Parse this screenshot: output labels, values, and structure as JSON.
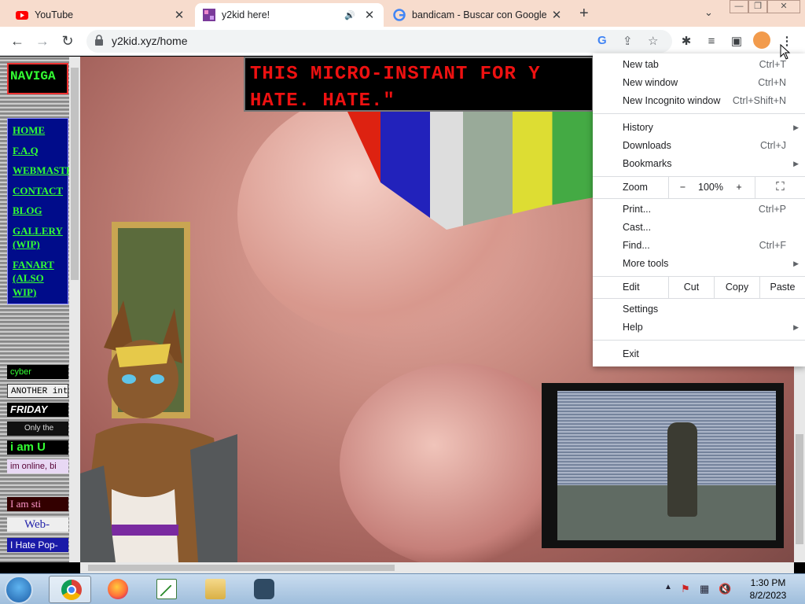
{
  "tabs": [
    {
      "title": "YouTube",
      "favicon": "youtube-icon"
    },
    {
      "title": "y2kid here!",
      "favicon": "site-icon",
      "audio": true
    },
    {
      "title": "bandicam - Buscar con Google",
      "favicon": "google-icon"
    }
  ],
  "address": {
    "url": "y2kid.xyz/home"
  },
  "page": {
    "nav_header": "NAVIGA",
    "nav_links": [
      "HOME",
      "F.A.Q",
      "WEBMASTE",
      "CONTACT",
      "BLOG",
      "GALLERY (WIP)",
      "FANART (ALSO WIP)"
    ],
    "badges": [
      "cyber",
      "ANOTHER inte",
      "FRIDAY",
      "Only the",
      "i am U",
      "im online, bi",
      "I am sti",
      "Web-",
      "I Hate Pop-"
    ],
    "banner_line1": "THIS MICRO-INSTANT FOR Y",
    "banner_line2": "HATE. HATE.\""
  },
  "menu": {
    "items_group1": [
      {
        "label": "New tab",
        "shortcut": "Ctrl+T"
      },
      {
        "label": "New window",
        "shortcut": "Ctrl+N"
      },
      {
        "label": "New Incognito window",
        "shortcut": "Ctrl+Shift+N"
      }
    ],
    "items_group2": [
      {
        "label": "History",
        "submenu": true
      },
      {
        "label": "Downloads",
        "shortcut": "Ctrl+J"
      },
      {
        "label": "Bookmarks",
        "submenu": true
      }
    ],
    "zoom": {
      "label": "Zoom",
      "minus": "−",
      "value": "100%",
      "plus": "+"
    },
    "items_group3": [
      {
        "label": "Print...",
        "shortcut": "Ctrl+P"
      },
      {
        "label": "Cast..."
      },
      {
        "label": "Find...",
        "shortcut": "Ctrl+F"
      },
      {
        "label": "More tools",
        "submenu": true
      }
    ],
    "edit": {
      "label": "Edit",
      "cut": "Cut",
      "copy": "Copy",
      "paste": "Paste"
    },
    "items_group4": [
      {
        "label": "Settings"
      },
      {
        "label": "Help",
        "submenu": true
      }
    ],
    "exit": "Exit"
  },
  "taskbar": {
    "time": "1:30 PM",
    "date": "8/2/2023",
    "apps": [
      "chrome-icon",
      "firefox-icon",
      "chart-app-icon",
      "explorer-icon",
      "bandicam-icon"
    ]
  },
  "colors": {
    "tabstrip": "#f7dccd",
    "menu_bg": "#ffffff",
    "nav_text": "#33ff33",
    "banner_text": "#ee1111"
  }
}
